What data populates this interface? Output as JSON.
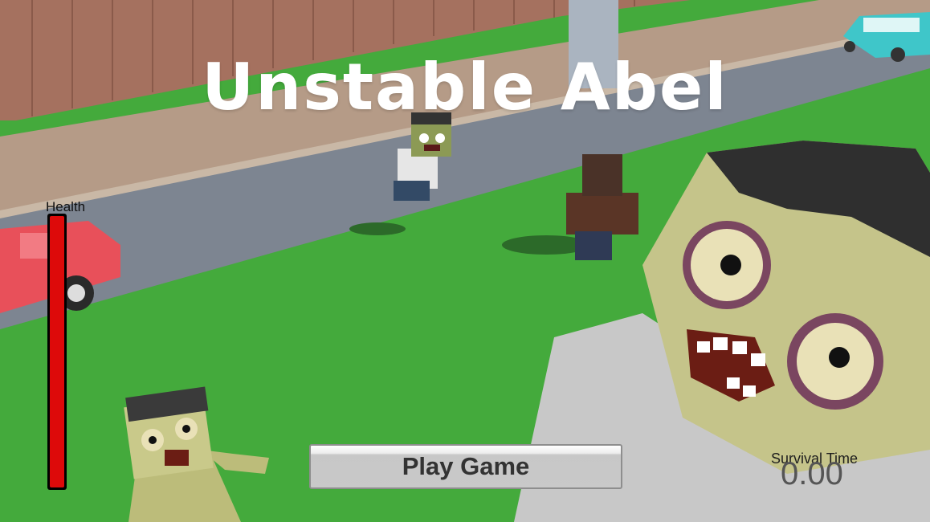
{
  "game": {
    "title": "Unstable Abel",
    "play_button_label": "Play Game",
    "health_label": "Health",
    "health_fraction": 1.0,
    "survival_label": "Survival Time",
    "survival_value": "0.00"
  },
  "colors": {
    "grass": "#3fa83a",
    "health_fill": "#dd0a0a",
    "title": "#ffffff"
  }
}
